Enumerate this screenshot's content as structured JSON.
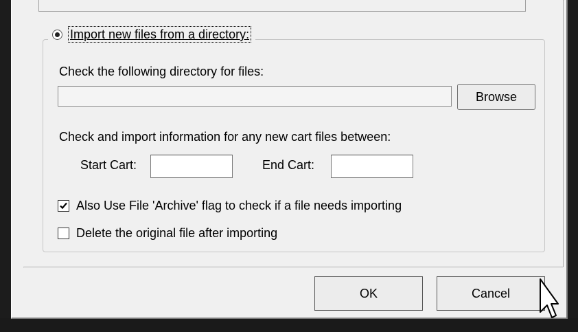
{
  "import_group": {
    "legend": "Import new files from a directory:",
    "legend_selected": true,
    "directory_label": "Check the following directory for files:",
    "directory_value": "",
    "browse_label": "Browse",
    "range_label": "Check and import information for any new cart files between:",
    "start_cart_label": "Start Cart:",
    "start_cart_value": "",
    "end_cart_label": "End Cart:",
    "end_cart_value": "",
    "archive_flag": {
      "label": "Also Use File 'Archive' flag to check if a file needs importing",
      "checked": true
    },
    "delete_original": {
      "label": "Delete the original file after importing",
      "checked": false
    }
  },
  "dialog_buttons": {
    "ok_label": "OK",
    "cancel_label": "Cancel"
  },
  "colors": {
    "window_bg": "#f0f0f0",
    "desktop_edge": "#1c1c1c"
  },
  "icons": {
    "cursor": "mouse-pointer-icon"
  }
}
